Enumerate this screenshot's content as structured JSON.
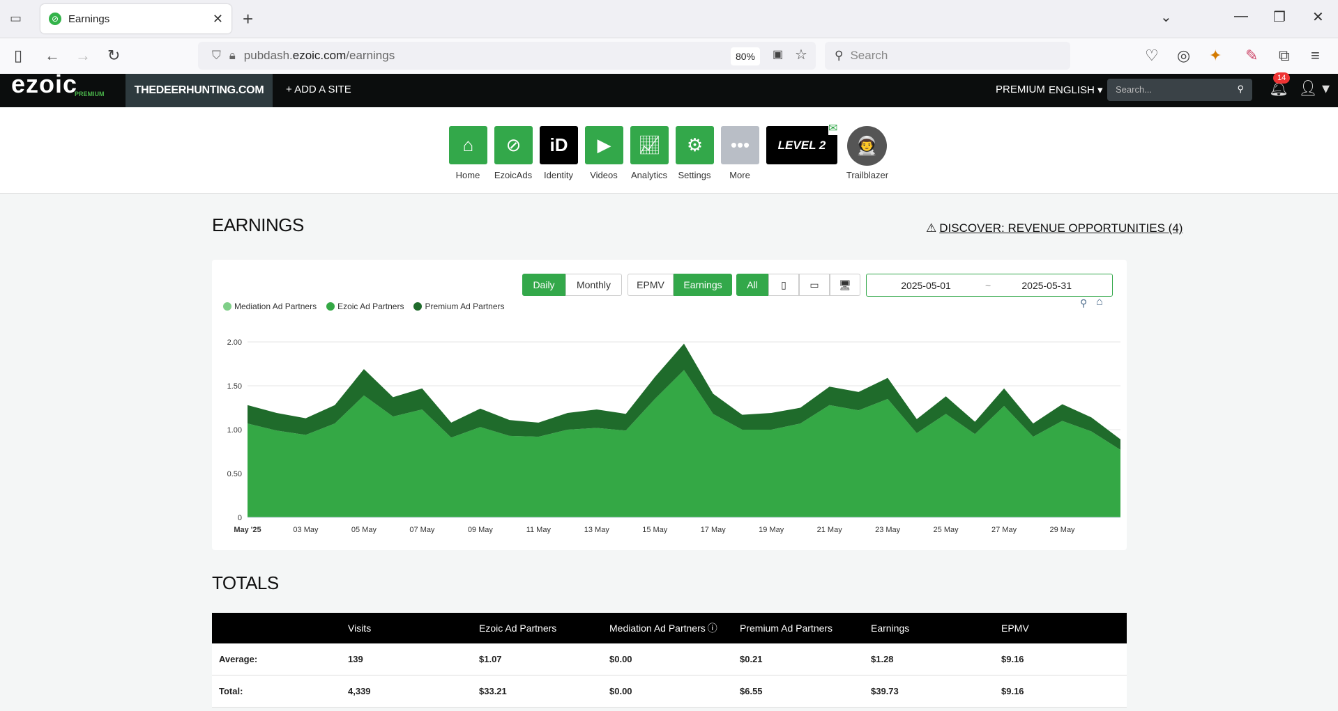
{
  "browser": {
    "tab_title": "Earnings",
    "url_domain_prefix": "pubdash.",
    "url_domain": "ezoic.com",
    "url_path": "/earnings",
    "zoom": "80%",
    "search_placeholder": "Search"
  },
  "nav": {
    "logo": "ezoic",
    "logo_sub": "PREMIUM",
    "site": "THEDEERHUNTING.COM",
    "add_site": "+ ADD A SITE",
    "premium": "PREMIUM",
    "language": "ENGLISH",
    "search_placeholder": "Search...",
    "notifications": "14"
  },
  "apps": [
    {
      "label": "Home",
      "icon": "home-icon"
    },
    {
      "label": "EzoicAds",
      "icon": "ezoicads-icon"
    },
    {
      "label": "Identity",
      "icon": "identity-icon"
    },
    {
      "label": "Videos",
      "icon": "videos-icon"
    },
    {
      "label": "Analytics",
      "icon": "analytics-icon"
    },
    {
      "label": "Settings",
      "icon": "gear-icon"
    },
    {
      "label": "More",
      "icon": "more-icon"
    }
  ],
  "level_badge": "LEVEL 2",
  "trailblazer": "Trailblazer",
  "page": {
    "title": "EARNINGS",
    "discover": "DISCOVER: REVENUE OPPORTUNITIES (4)",
    "totals_title": "TOTALS"
  },
  "controls": {
    "daily": "Daily",
    "monthly": "Monthly",
    "epmv": "EPMV",
    "earnings": "Earnings",
    "all": "All",
    "date_from": "2025-05-01",
    "date_sep": "~",
    "date_to": "2025-05-31"
  },
  "chart_data": {
    "type": "area",
    "stacked": true,
    "x_ticks": [
      "May '25",
      "03 May",
      "05 May",
      "07 May",
      "09 May",
      "11 May",
      "13 May",
      "15 May",
      "17 May",
      "19 May",
      "21 May",
      "23 May",
      "25 May",
      "27 May",
      "29 May"
    ],
    "y_ticks": [
      "0",
      "0.50",
      "1.00",
      "1.50",
      "2.00"
    ],
    "ylim": [
      0,
      2
    ],
    "series": [
      {
        "name": "Mediation Ad Partners",
        "color": "#7fcf88",
        "values": [
          0,
          0,
          0,
          0,
          0,
          0,
          0,
          0,
          0,
          0,
          0,
          0,
          0,
          0,
          0,
          0,
          0,
          0,
          0,
          0,
          0,
          0,
          0,
          0,
          0,
          0,
          0,
          0,
          0,
          0,
          0
        ]
      },
      {
        "name": "Ezoic Ad Partners",
        "color": "#34a845",
        "values": [
          1.07,
          0.99,
          0.94,
          1.07,
          1.39,
          1.15,
          1.23,
          0.91,
          1.03,
          0.93,
          0.92,
          1.0,
          1.02,
          0.99,
          1.35,
          1.68,
          1.18,
          1.0,
          1.0,
          1.07,
          1.28,
          1.22,
          1.35,
          0.96,
          1.18,
          0.95,
          1.27,
          0.92,
          1.1,
          0.98,
          0.77
        ]
      },
      {
        "name": "Premium Ad Partners",
        "color": "#1f6b2b",
        "values": [
          0.21,
          0.2,
          0.19,
          0.21,
          0.3,
          0.22,
          0.24,
          0.17,
          0.21,
          0.18,
          0.16,
          0.19,
          0.21,
          0.19,
          0.25,
          0.3,
          0.23,
          0.17,
          0.19,
          0.18,
          0.21,
          0.21,
          0.24,
          0.16,
          0.2,
          0.14,
          0.2,
          0.15,
          0.19,
          0.16,
          0.12
        ]
      }
    ]
  },
  "table": {
    "headers": [
      "",
      "Visits",
      "Ezoic Ad Partners",
      "Mediation Ad Partners",
      "Premium Ad Partners",
      "Earnings",
      "EPMV"
    ],
    "rows": [
      [
        "Average:",
        "139",
        "$1.07",
        "$0.00",
        "$0.21",
        "$1.28",
        "$9.16"
      ],
      [
        "Total:",
        "4,339",
        "$33.21",
        "$0.00",
        "$6.55",
        "$39.73",
        "$9.16"
      ]
    ]
  }
}
